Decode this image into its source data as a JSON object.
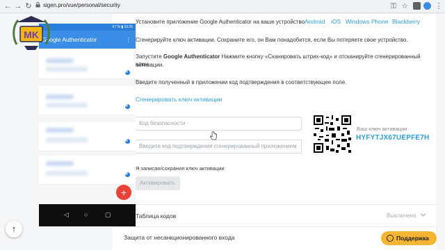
{
  "browser": {
    "url": "sigen.pro/vue/personal/security",
    "nav_icons": [
      "back-arrow-icon",
      "forward-arrow-icon",
      "reload-icon"
    ]
  },
  "setup": {
    "step1_text": "Установите приложение Google Authenticator на ваше устройство",
    "platforms": [
      "Android",
      "iOS",
      "Windows Phone",
      "Blackberry"
    ],
    "step2_text": "Сгенерируйте ключ активации. Сохраните его, он Вам понадобится, если Вы потеряете свое устройство.",
    "step3_prefix": "Запустите ",
    "step3_app": "Google Authenticator",
    "step3_rest": " Нажмите кнопку «Сканировать штрих-код» и отсканируйте сгенерированный ключ",
    "step3_line2": "активации.",
    "step4_text": "Введите полученный в приложении код подтверждения в соответствующее поле.",
    "generate_link": "Сгенерировать ключ активации",
    "security_code_placeholder": "Код безопасности",
    "confirm_code_placeholder": "Введите код подтверждения сгенерированный приложением",
    "checkbox_label": "Я записал/сохранил ключ активации",
    "activate_button": "Активировать",
    "key_label": "Ваш ключ активации",
    "key_value": "HYFYTJX67UEPFE7H"
  },
  "sections": [
    {
      "title": "Таблица кодов",
      "status": "Выключено"
    },
    {
      "title": "Защита от несанкционированного входа"
    }
  ],
  "phone": {
    "app_title": "Google Authenticator",
    "status_bar": "67 % ▮ 13:25"
  },
  "logo_text": "MK",
  "support_button": "Поддержка",
  "colors": {
    "accent": "#2a9fd6",
    "support": "#f5b432",
    "fab": "#ea4335",
    "phone_bar": "#3a8ee6"
  }
}
